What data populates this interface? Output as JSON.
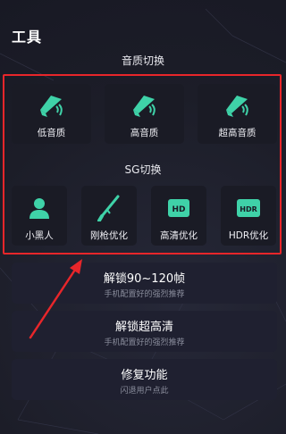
{
  "page_title": "工具",
  "quality_section": {
    "title": "音质切换",
    "items": [
      {
        "label": "低音质",
        "icon": "speaker-icon"
      },
      {
        "label": "高音质",
        "icon": "speaker-icon"
      },
      {
        "label": "超高音质",
        "icon": "speaker-icon"
      }
    ]
  },
  "sg_section": {
    "title": "SG切换",
    "items": [
      {
        "label": "小黑人",
        "icon": "person-icon"
      },
      {
        "label": "刚枪优化",
        "icon": "rifle-icon"
      },
      {
        "label": "高清优化",
        "icon": "hd-icon",
        "badge": "HD"
      },
      {
        "label": "HDR优化",
        "icon": "hdr-icon",
        "badge": "HDR"
      }
    ]
  },
  "features": [
    {
      "title": "解锁90~120帧",
      "subtitle": "手机配置好的强烈推荐"
    },
    {
      "title": "解锁超高清",
      "subtitle": "手机配置好的强烈推荐"
    },
    {
      "title": "修复功能",
      "subtitle": "闪退用户点此"
    }
  ],
  "colors": {
    "accent": "#3fd2a8",
    "highlight": "#e8262a",
    "background": "#1e1f2b"
  }
}
